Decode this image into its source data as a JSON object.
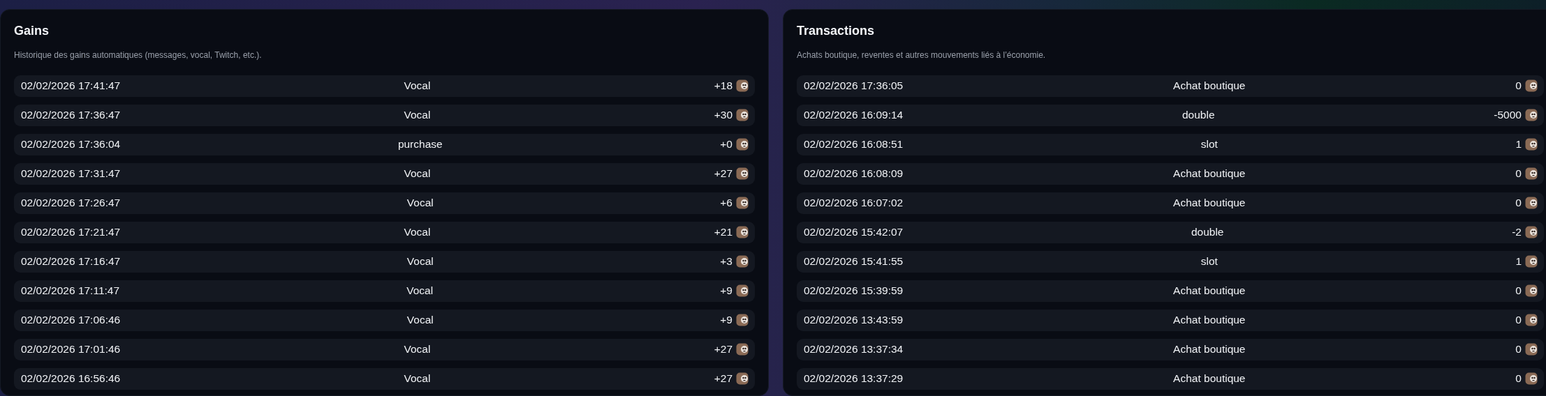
{
  "panels": [
    {
      "title": "Gains",
      "subtitle": "Historique des gains automatiques (messages, vocal, Twitch, etc.).",
      "rows": [
        {
          "date": "02/02/2026 17:41:47",
          "label": "Vocal",
          "amount": "+18"
        },
        {
          "date": "02/02/2026 17:36:47",
          "label": "Vocal",
          "amount": "+30"
        },
        {
          "date": "02/02/2026 17:36:04",
          "label": "purchase",
          "amount": "+0"
        },
        {
          "date": "02/02/2026 17:31:47",
          "label": "Vocal",
          "amount": "+27"
        },
        {
          "date": "02/02/2026 17:26:47",
          "label": "Vocal",
          "amount": "+6"
        },
        {
          "date": "02/02/2026 17:21:47",
          "label": "Vocal",
          "amount": "+21"
        },
        {
          "date": "02/02/2026 17:16:47",
          "label": "Vocal",
          "amount": "+3"
        },
        {
          "date": "02/02/2026 17:11:47",
          "label": "Vocal",
          "amount": "+9"
        },
        {
          "date": "02/02/2026 17:06:46",
          "label": "Vocal",
          "amount": "+9"
        },
        {
          "date": "02/02/2026 17:01:46",
          "label": "Vocal",
          "amount": "+27"
        },
        {
          "date": "02/02/2026 16:56:46",
          "label": "Vocal",
          "amount": "+27"
        }
      ]
    },
    {
      "title": "Transactions",
      "subtitle": "Achats boutique, reventes et autres mouvements liés à l’économie.",
      "rows": [
        {
          "date": "02/02/2026 17:36:05",
          "label": "Achat boutique",
          "amount": "0"
        },
        {
          "date": "02/02/2026 16:09:14",
          "label": "double",
          "amount": "-5000"
        },
        {
          "date": "02/02/2026 16:08:51",
          "label": "slot",
          "amount": "1"
        },
        {
          "date": "02/02/2026 16:08:09",
          "label": "Achat boutique",
          "amount": "0"
        },
        {
          "date": "02/02/2026 16:07:02",
          "label": "Achat boutique",
          "amount": "0"
        },
        {
          "date": "02/02/2026 15:42:07",
          "label": "double",
          "amount": "-2"
        },
        {
          "date": "02/02/2026 15:41:55",
          "label": "slot",
          "amount": "1"
        },
        {
          "date": "02/02/2026 15:39:59",
          "label": "Achat boutique",
          "amount": "0"
        },
        {
          "date": "02/02/2026 13:43:59",
          "label": "Achat boutique",
          "amount": "0"
        },
        {
          "date": "02/02/2026 13:37:34",
          "label": "Achat boutique",
          "amount": "0"
        },
        {
          "date": "02/02/2026 13:37:29",
          "label": "Achat boutique",
          "amount": "0"
        }
      ]
    }
  ]
}
